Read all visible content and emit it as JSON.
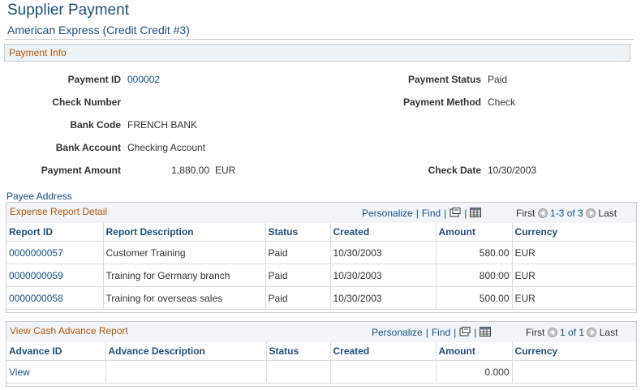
{
  "header": {
    "title": "Supplier Payment",
    "subtitle": "American Express (Credit Credit #3)"
  },
  "payment_info": {
    "section_title": "Payment Info",
    "payment_id_label": "Payment ID",
    "payment_id": "000002",
    "check_number_label": "Check Number",
    "check_number": "",
    "bank_code_label": "Bank Code",
    "bank_code": "FRENCH BANK",
    "bank_account_label": "Bank Account",
    "bank_account": "Checking Account",
    "payment_amount_label": "Payment Amount",
    "payment_amount": "1,880.00",
    "payment_currency": "EUR",
    "payment_status_label": "Payment Status",
    "payment_status": "Paid",
    "payment_method_label": "Payment Method",
    "payment_method": "Check",
    "check_date_label": "Check Date",
    "check_date": "10/30/2003"
  },
  "payee_address_link": "Payee Address",
  "expense_grid": {
    "title": "Expense Report Detail",
    "personalize": "Personalize",
    "find": "Find",
    "first": "First",
    "range": "1-3 of 3",
    "last": "Last",
    "columns": {
      "report_id": "Report ID",
      "description": "Report Description",
      "status": "Status",
      "created": "Created",
      "amount": "Amount",
      "currency": "Currency"
    },
    "rows": [
      {
        "report_id": "0000000057",
        "description": "Customer Training",
        "status": "Paid",
        "created": "10/30/2003",
        "amount": "580.00",
        "currency": "EUR"
      },
      {
        "report_id": "0000000059",
        "description": "Training for Germany branch",
        "status": "Paid",
        "created": "10/30/2003",
        "amount": "800.00",
        "currency": "EUR"
      },
      {
        "report_id": "0000000058",
        "description": "Training for overseas sales",
        "status": "Paid",
        "created": "10/30/2003",
        "amount": "500.00",
        "currency": "EUR"
      }
    ]
  },
  "cash_advance_grid": {
    "title": "View Cash Advance Report",
    "personalize": "Personalize",
    "find": "Find",
    "first": "First",
    "range": "1 of 1",
    "last": "Last",
    "columns": {
      "advance_id": "Advance ID",
      "description": "Advance Description",
      "status": "Status",
      "created": "Created",
      "amount": "Amount",
      "currency": "Currency"
    },
    "rows": [
      {
        "advance_id": "View",
        "description": "",
        "status": "",
        "created": "",
        "amount": "0.000",
        "currency": ""
      }
    ]
  },
  "icons": {
    "zoom": "zoom-grid-icon",
    "download": "download-spreadsheet-icon",
    "prev": "previous-arrow-icon",
    "next": "next-arrow-icon"
  },
  "colors": {
    "title": "#1c4f7c",
    "section_heading": "#b5570c",
    "link": "#1a4f8a"
  }
}
